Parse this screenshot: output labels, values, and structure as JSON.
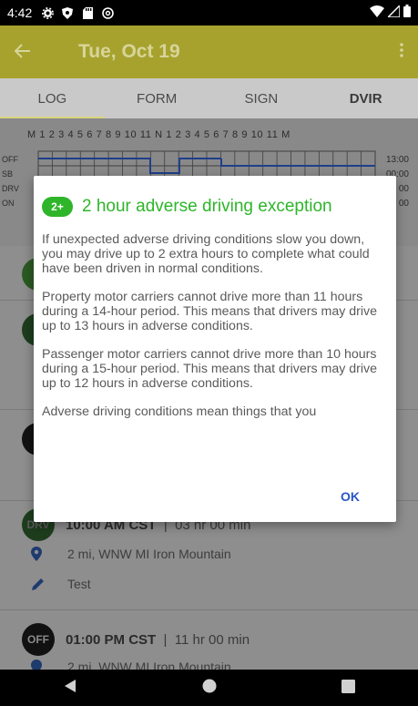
{
  "status_bar": {
    "time": "4:42"
  },
  "app_bar": {
    "title": "Tue, Oct 19"
  },
  "tabs": [
    {
      "label": "LOG"
    },
    {
      "label": "FORM"
    },
    {
      "label": "SIGN"
    },
    {
      "label": "DVIR"
    }
  ],
  "graph": {
    "hour_labels": "M 1 2 3 4 5 6 7 8 9 10 11 N 1 2 3 4 5 6 7 8 9 10 11 M",
    "rows": [
      {
        "label": "OFF",
        "total": "13:00"
      },
      {
        "label": "SB",
        "total": "00:00"
      },
      {
        "label": "DRV",
        "total": "00"
      },
      {
        "label": "ON",
        "total": "00"
      }
    ]
  },
  "log_entries": [
    {
      "badge": "DRV",
      "time": "10:00 AM CST",
      "duration": "03 hr  00 min",
      "location": "2 mi, WNW MI Iron Mountain",
      "note": "Test"
    },
    {
      "badge": "OFF",
      "time": "01:00 PM CST",
      "duration": "11 hr  00 min",
      "location": "2 mi, WNW MI Iron Mountain"
    }
  ],
  "dialog": {
    "badge": "2+",
    "title": "2 hour adverse driving exception",
    "paragraphs": [
      "If unexpected adverse driving conditions slow you down, you may drive up to 2 extra hours to complete what could have been driven in normal conditions.",
      "Property motor carriers cannot drive more than 11 hours during a 14-hour period. This means that drivers may drive up to 13 hours in adverse conditions.",
      "Passenger motor carriers cannot drive more than 10 hours during a 15-hour period. This means that drivers may drive up to 12 hours in adverse conditions.",
      "Adverse driving conditions mean things that you"
    ],
    "ok_label": "OK"
  },
  "colors": {
    "accent_green": "#2eb52a",
    "app_bar": "#a7a22e",
    "ok_blue": "#2a57c4"
  }
}
